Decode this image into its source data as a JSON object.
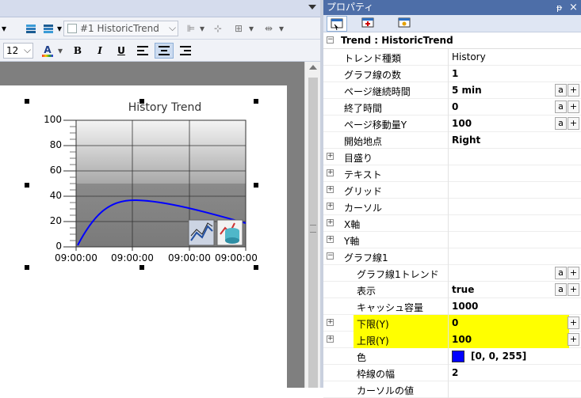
{
  "toolbar": {
    "object_select": "#1 HistoricTrend",
    "font_size": "12",
    "bold": "B",
    "italic": "I",
    "underline": "U"
  },
  "chart": {
    "title": "History Trend",
    "y_ticks": [
      "100",
      "80",
      "60",
      "40",
      "20",
      "0"
    ],
    "x_ticks": [
      "09:00:00",
      "09:00:00",
      "09:00:00",
      "09:00:00"
    ]
  },
  "properties": {
    "header": "プロパティ",
    "pin_icon": "ᵽ",
    "close_icon": "×",
    "group_title": "Trend : HistoricTrend",
    "rows": [
      {
        "label": "トレンド種類",
        "value": "History"
      },
      {
        "label": "グラフ線の数",
        "value": "1"
      },
      {
        "label": "ページ継続時間",
        "value": "5 min"
      },
      {
        "label": "終了時間",
        "value": "0"
      },
      {
        "label": "ページ移動量Y",
        "value": "100"
      },
      {
        "label": "開始地点",
        "value": "Right"
      },
      {
        "label": "目盛り",
        "value": ""
      },
      {
        "label": "テキスト",
        "value": ""
      },
      {
        "label": "グリッド",
        "value": ""
      },
      {
        "label": "カーソル",
        "value": ""
      },
      {
        "label": "X軸",
        "value": ""
      },
      {
        "label": "Y軸",
        "value": ""
      },
      {
        "label": "グラフ線1",
        "value": ""
      },
      {
        "label": "グラフ線1トレンド",
        "value": ""
      },
      {
        "label": "表示",
        "value": "true"
      },
      {
        "label": "キャッシュ容量",
        "value": "1000"
      },
      {
        "label": "下限(Y)",
        "value": "0"
      },
      {
        "label": "上限(Y)",
        "value": "100"
      },
      {
        "label": "色",
        "value": "[0, 0, 255]"
      },
      {
        "label": "枠線の幅",
        "value": "2"
      },
      {
        "label": "カーソルの値",
        "value": ""
      }
    ],
    "btn_a": "a",
    "btn_plus": "+"
  },
  "colors": {
    "trend_line": "#0000ff",
    "highlight": "#ffff00",
    "panel_header": "#4d6ea8"
  }
}
